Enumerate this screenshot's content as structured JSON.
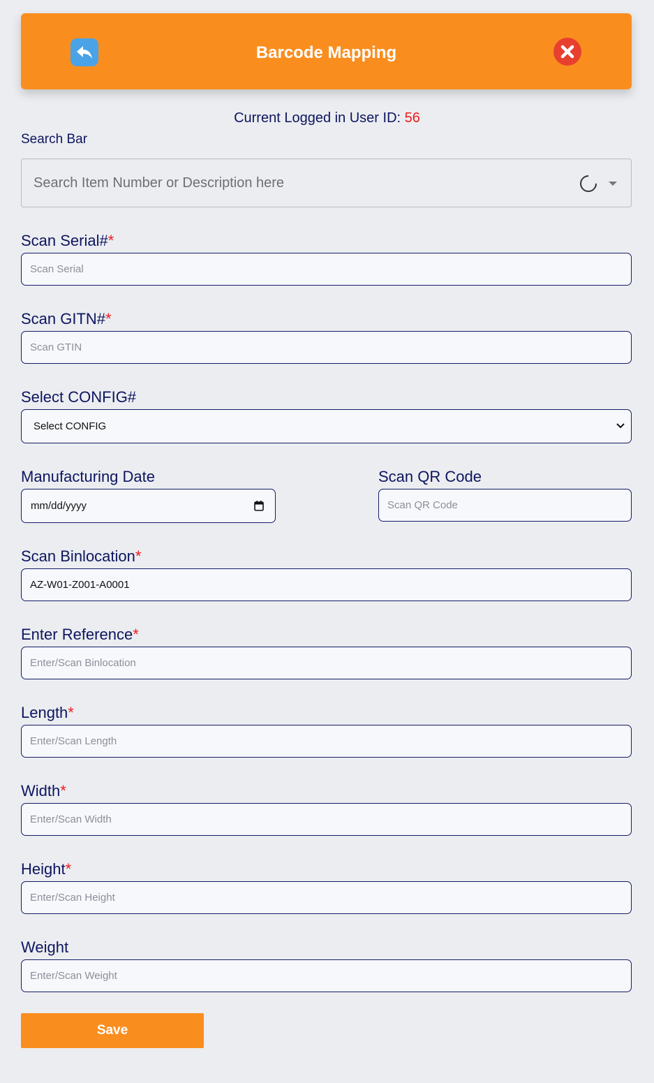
{
  "header": {
    "title": "Barcode Mapping",
    "back_icon": "reply-arrow-icon",
    "close_icon": "close-x-icon",
    "accent_color": "#f98e1f"
  },
  "user": {
    "prefix": "Current Logged in User ID:",
    "id": "56"
  },
  "search": {
    "label": "Search Bar",
    "placeholder": "Search Item Number or Description here"
  },
  "fields": {
    "serial": {
      "label": "Scan Serial#",
      "required": "*",
      "placeholder": "Scan Serial"
    },
    "gtin": {
      "label": "Scan GITN#",
      "required": "*",
      "placeholder": "Scan GTIN"
    },
    "config": {
      "label": "Select CONFIG#",
      "selected": "Select CONFIG"
    },
    "mfg_date": {
      "label": "Manufacturing Date",
      "value": "mm/dd/yyyy"
    },
    "qr": {
      "label": "Scan QR Code",
      "placeholder": "Scan QR Code"
    },
    "binlocation": {
      "label": "Scan Binlocation",
      "required": "*",
      "value": "AZ-W01-Z001-A0001"
    },
    "reference": {
      "label": "Enter Reference",
      "required": "*",
      "placeholder": "Enter/Scan Binlocation"
    },
    "length": {
      "label": "Length",
      "required": "*",
      "placeholder": "Enter/Scan Length"
    },
    "width": {
      "label": "Width",
      "required": "*",
      "placeholder": "Enter/Scan Width"
    },
    "height": {
      "label": "Height",
      "required": "*",
      "placeholder": "Enter/Scan Height"
    },
    "weight": {
      "label": "Weight",
      "placeholder": "Enter/Scan Weight"
    }
  },
  "save_label": "Save"
}
